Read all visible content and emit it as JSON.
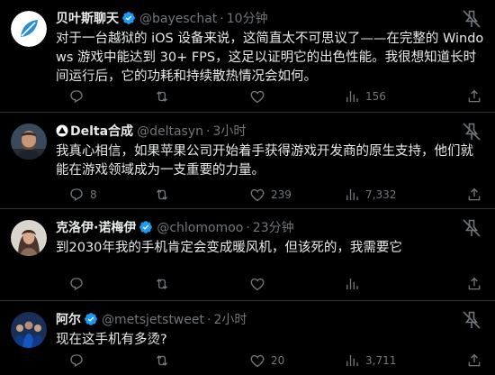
{
  "tweets": [
    {
      "name": "贝叶斯聊天",
      "handle": "@bayeschat",
      "sep": "·",
      "time": "10分钟",
      "text": "对于一台越狱的 iOS 设备来说，这简直太不可思议了——在完整的 Windows 游戏中能达到 30+ FPS，这足以证明它的出色性能。我很想知道长时间运行后，它的功耗和持续散热情况会如何。",
      "replies": "",
      "retweets": "",
      "likes": "",
      "views": "156"
    },
    {
      "name": "Delta合成",
      "handle": "@deltasyn",
      "sep": "·",
      "time": "3小时",
      "text": "我真心相信，如果苹果公司开始着手获得游戏开发商的原生支持，他们就能在游戏领域成为一支重要的力量。",
      "replies": "8",
      "retweets": "",
      "likes": "239",
      "views": "7,332"
    },
    {
      "name": "克洛伊·诺梅伊",
      "handle": "@chlomomoo",
      "sep": "·",
      "time": "23分钟",
      "text": "到2030年我的手机肯定会变成暖风机，但该死的，我需要它",
      "replies": "",
      "retweets": "",
      "likes": "",
      "views": ""
    },
    {
      "name": "阿尔",
      "handle": "@metsjetstweet",
      "sep": "·",
      "time": "2小时",
      "text": "现在这手机有多烫?",
      "replies": "",
      "retweets": "",
      "likes": "20",
      "views": "3,711"
    }
  ],
  "colors": {
    "background": "#000000",
    "text": "#e7e9ea",
    "muted": "#71767b",
    "verified": "#1d9bf0",
    "divider": "#2f3336"
  },
  "icons": [
    "verified-badge-icon",
    "more-icon",
    "reply-icon",
    "retweet-icon",
    "like-icon",
    "views-icon",
    "share-icon"
  ]
}
